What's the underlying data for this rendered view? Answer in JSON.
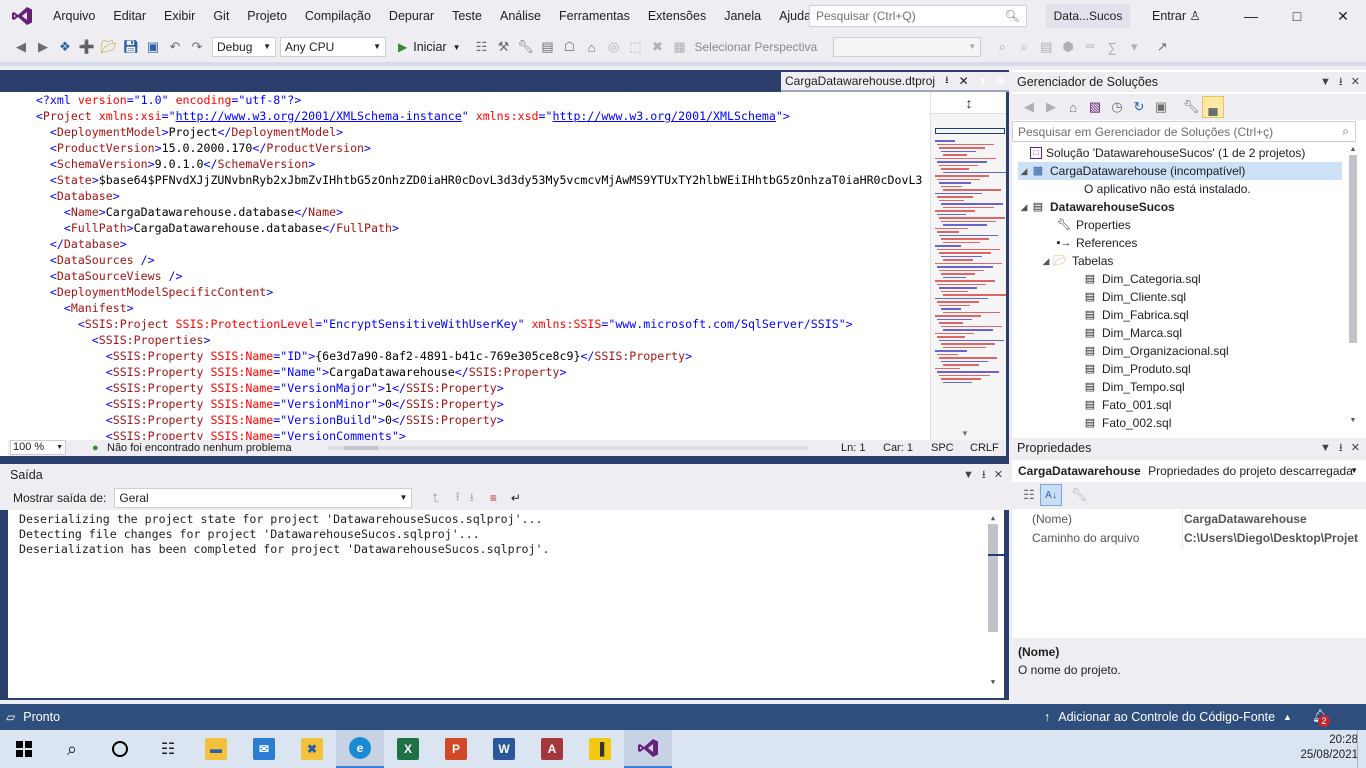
{
  "menu": {
    "items": [
      "Arquivo",
      "Editar",
      "Exibir",
      "Git",
      "Projeto",
      "Compilação",
      "Depurar",
      "Teste",
      "Análise",
      "Ferramentas",
      "Extensões",
      "Janela",
      "Ajuda"
    ],
    "search_placeholder": "Pesquisar (Ctrl+Q)",
    "solution_short": "Data...Sucos",
    "signin": "Entrar"
  },
  "toolbar": {
    "config": "Debug",
    "platform": "Any CPU",
    "start": "Iniciar",
    "perspective": "Selecionar Perspectiva"
  },
  "editor": {
    "tab_title": "CargaDatawarehouse.dtproj",
    "lines": [
      {
        "indent": 2,
        "parts": [
          [
            "pu",
            "<?xml "
          ],
          [
            "at",
            "version"
          ],
          [
            "pu",
            "=\""
          ],
          [
            "av",
            "1.0"
          ],
          [
            "pu",
            "\" "
          ],
          [
            "at",
            "encoding"
          ],
          [
            "pu",
            "=\""
          ],
          [
            "av",
            "utf-8"
          ],
          [
            "pu",
            "\"?>"
          ]
        ]
      },
      {
        "indent": 2,
        "parts": [
          [
            "pu",
            "<"
          ],
          [
            "tb",
            "Project"
          ],
          [
            "at",
            " xmlns:xsi"
          ],
          [
            "pu",
            "=\""
          ],
          [
            "lk",
            "http://www.w3.org/2001/XMLSchema-instance"
          ],
          [
            "pu",
            "\""
          ],
          [
            "at",
            " xmlns:xsd"
          ],
          [
            "pu",
            "=\""
          ],
          [
            "lk",
            "http://www.w3.org/2001/XMLSchema"
          ],
          [
            "pu",
            "\">"
          ]
        ]
      },
      {
        "indent": 4,
        "parts": [
          [
            "pu",
            "<"
          ],
          [
            "tb",
            "DeploymentModel"
          ],
          [
            "pu",
            ">"
          ],
          [
            "tx",
            "Project"
          ],
          [
            "pu",
            "</"
          ],
          [
            "tb",
            "DeploymentModel"
          ],
          [
            "pu",
            ">"
          ]
        ]
      },
      {
        "indent": 4,
        "parts": [
          [
            "pu",
            "<"
          ],
          [
            "tb",
            "ProductVersion"
          ],
          [
            "pu",
            ">"
          ],
          [
            "tx",
            "15.0.2000.170"
          ],
          [
            "pu",
            "</"
          ],
          [
            "tb",
            "ProductVersion"
          ],
          [
            "pu",
            ">"
          ]
        ]
      },
      {
        "indent": 4,
        "parts": [
          [
            "pu",
            "<"
          ],
          [
            "tb",
            "SchemaVersion"
          ],
          [
            "pu",
            ">"
          ],
          [
            "tx",
            "9.0.1.0"
          ],
          [
            "pu",
            "</"
          ],
          [
            "tb",
            "SchemaVersion"
          ],
          [
            "pu",
            ">"
          ]
        ]
      },
      {
        "indent": 4,
        "parts": [
          [
            "pu",
            "<"
          ],
          [
            "tb",
            "State"
          ],
          [
            "pu",
            ">"
          ],
          [
            "tx",
            "$base64$PFNvdXJjZUNvbnRyb2xJbmZvIHhtbG5zOnhzZD0iaHR0cDovL3d3dy53My5vcmcvMjAwMS9YTUxTY2hlbWEiIHhtbG5zOnhzaT0iaHR0cDovL3"
          ]
        ]
      },
      {
        "indent": 4,
        "parts": [
          [
            "pu",
            "<"
          ],
          [
            "tb",
            "Database"
          ],
          [
            "pu",
            ">"
          ]
        ]
      },
      {
        "indent": 6,
        "parts": [
          [
            "pu",
            "<"
          ],
          [
            "tb",
            "Name"
          ],
          [
            "pu",
            ">"
          ],
          [
            "tx",
            "CargaDatawarehouse.database"
          ],
          [
            "pu",
            "</"
          ],
          [
            "tb",
            "Name"
          ],
          [
            "pu",
            ">"
          ]
        ]
      },
      {
        "indent": 6,
        "parts": [
          [
            "pu",
            "<"
          ],
          [
            "tb",
            "FullPath"
          ],
          [
            "pu",
            ">"
          ],
          [
            "tx",
            "CargaDatawarehouse.database"
          ],
          [
            "pu",
            "</"
          ],
          [
            "tb",
            "FullPath"
          ],
          [
            "pu",
            ">"
          ]
        ]
      },
      {
        "indent": 4,
        "parts": [
          [
            "pu",
            "</"
          ],
          [
            "tb",
            "Database"
          ],
          [
            "pu",
            ">"
          ]
        ]
      },
      {
        "indent": 4,
        "parts": [
          [
            "pu",
            "<"
          ],
          [
            "tb",
            "DataSources"
          ],
          [
            "pu",
            " />"
          ]
        ]
      },
      {
        "indent": 4,
        "parts": [
          [
            "pu",
            "<"
          ],
          [
            "tb",
            "DataSourceViews"
          ],
          [
            "pu",
            " />"
          ]
        ]
      },
      {
        "indent": 4,
        "parts": [
          [
            "pu",
            "<"
          ],
          [
            "tb",
            "DeploymentModelSpecificContent"
          ],
          [
            "pu",
            ">"
          ]
        ]
      },
      {
        "indent": 6,
        "parts": [
          [
            "pu",
            "<"
          ],
          [
            "tb",
            "Manifest"
          ],
          [
            "pu",
            ">"
          ]
        ]
      },
      {
        "indent": 8,
        "parts": [
          [
            "pu",
            "<"
          ],
          [
            "tb",
            "SSIS:Project"
          ],
          [
            "at",
            " SSIS:ProtectionLevel"
          ],
          [
            "pu",
            "=\""
          ],
          [
            "av",
            "EncryptSensitiveWithUserKey"
          ],
          [
            "pu",
            "\""
          ],
          [
            "at",
            " xmlns:SSIS"
          ],
          [
            "pu",
            "=\""
          ],
          [
            "av",
            "www.microsoft.com/SqlServer/SSIS"
          ],
          [
            "pu",
            "\">"
          ]
        ]
      },
      {
        "indent": 10,
        "parts": [
          [
            "pu",
            "<"
          ],
          [
            "tb",
            "SSIS:Properties"
          ],
          [
            "pu",
            ">"
          ]
        ]
      },
      {
        "indent": 12,
        "parts": [
          [
            "pu",
            "<"
          ],
          [
            "tb",
            "SSIS:Property"
          ],
          [
            "at",
            " SSIS:Name"
          ],
          [
            "pu",
            "=\""
          ],
          [
            "av",
            "ID"
          ],
          [
            "pu",
            "\">"
          ],
          [
            "tx",
            "{6e3d7a90-8af2-4891-b41c-769e305ce8c9}"
          ],
          [
            "pu",
            "</"
          ],
          [
            "tb",
            "SSIS:Property"
          ],
          [
            "pu",
            ">"
          ]
        ]
      },
      {
        "indent": 12,
        "parts": [
          [
            "pu",
            "<"
          ],
          [
            "tb",
            "SSIS:Property"
          ],
          [
            "at",
            " SSIS:Name"
          ],
          [
            "pu",
            "=\""
          ],
          [
            "av",
            "Name"
          ],
          [
            "pu",
            "\">"
          ],
          [
            "tx",
            "CargaDatawarehouse"
          ],
          [
            "pu",
            "</"
          ],
          [
            "tb",
            "SSIS:Property"
          ],
          [
            "pu",
            ">"
          ]
        ]
      },
      {
        "indent": 12,
        "parts": [
          [
            "pu",
            "<"
          ],
          [
            "tb",
            "SSIS:Property"
          ],
          [
            "at",
            " SSIS:Name"
          ],
          [
            "pu",
            "=\""
          ],
          [
            "av",
            "VersionMajor"
          ],
          [
            "pu",
            "\">"
          ],
          [
            "tx",
            "1"
          ],
          [
            "pu",
            "</"
          ],
          [
            "tb",
            "SSIS:Property"
          ],
          [
            "pu",
            ">"
          ]
        ]
      },
      {
        "indent": 12,
        "parts": [
          [
            "pu",
            "<"
          ],
          [
            "tb",
            "SSIS:Property"
          ],
          [
            "at",
            " SSIS:Name"
          ],
          [
            "pu",
            "=\""
          ],
          [
            "av",
            "VersionMinor"
          ],
          [
            "pu",
            "\">"
          ],
          [
            "tx",
            "0"
          ],
          [
            "pu",
            "</"
          ],
          [
            "tb",
            "SSIS:Property"
          ],
          [
            "pu",
            ">"
          ]
        ]
      },
      {
        "indent": 12,
        "parts": [
          [
            "pu",
            "<"
          ],
          [
            "tb",
            "SSIS:Property"
          ],
          [
            "at",
            " SSIS:Name"
          ],
          [
            "pu",
            "=\""
          ],
          [
            "av",
            "VersionBuild"
          ],
          [
            "pu",
            "\">"
          ],
          [
            "tx",
            "0"
          ],
          [
            "pu",
            "</"
          ],
          [
            "tb",
            "SSIS:Property"
          ],
          [
            "pu",
            ">"
          ]
        ]
      },
      {
        "indent": 12,
        "parts": [
          [
            "pu",
            "<"
          ],
          [
            "tb",
            "SSIS:Property"
          ],
          [
            "at",
            " SSIS:Name"
          ],
          [
            "pu",
            "=\""
          ],
          [
            "av",
            "VersionComments"
          ],
          [
            "pu",
            "\">"
          ]
        ]
      }
    ],
    "zoom": "100 %",
    "issues": "Não foi encontrado nenhum problema",
    "line": "Ln: 1",
    "char": "Car: 1",
    "spc": "SPC",
    "crlf": "CRLF"
  },
  "output": {
    "title": "Saída",
    "show_label": "Mostrar saída de:",
    "source": "Geral",
    "lines": [
      "Deserializing the project state for project 'DatawarehouseSucos.sqlproj'...",
      "Detecting file changes for project 'DatawarehouseSucos.sqlproj'...",
      "Deserialization has been completed for project 'DatawarehouseSucos.sqlproj'."
    ]
  },
  "solution_explorer": {
    "title": "Gerenciador de Soluções",
    "search_placeholder": "Pesquisar em Gerenciador de Soluções (Ctrl+ç)",
    "solution": "Solução 'DatawarehouseSucos' (1 de 2 projetos)",
    "project1": "CargaDatawarehouse (incompatível)",
    "project1_msg": "O aplicativo não está instalado.",
    "project2": "DatawarehouseSucos",
    "properties": "Properties",
    "references": "References",
    "folder": "Tabelas",
    "files": [
      "Dim_Categoria.sql",
      "Dim_Cliente.sql",
      "Dim_Fabrica.sql",
      "Dim_Marca.sql",
      "Dim_Organizacional.sql",
      "Dim_Produto.sql",
      "Dim_Tempo.sql",
      "Fato_001.sql",
      "Fato_002.sql"
    ]
  },
  "properties_panel": {
    "title": "Propriedades",
    "selected_name": "CargaDatawarehouse",
    "selected_type": "Propriedades do projeto descarregada",
    "rows": [
      {
        "key": "(Nome)",
        "value": "CargaDatawarehouse"
      },
      {
        "key": "Caminho do arquivo",
        "value": "C:\\Users\\Diego\\Desktop\\Projet"
      }
    ],
    "desc_title": "(Nome)",
    "desc_text": "O nome do projeto."
  },
  "statusbar": {
    "status": "Pronto",
    "source_control": "Adicionar ao Controle do Código-Fonte",
    "notifications": "2"
  },
  "taskbar": {
    "time": "20:28",
    "date": "25/08/2021"
  },
  "colors": {
    "accent": "#68217a",
    "statusbar": "#2e4e7e",
    "frame": "#2c3e6b"
  }
}
